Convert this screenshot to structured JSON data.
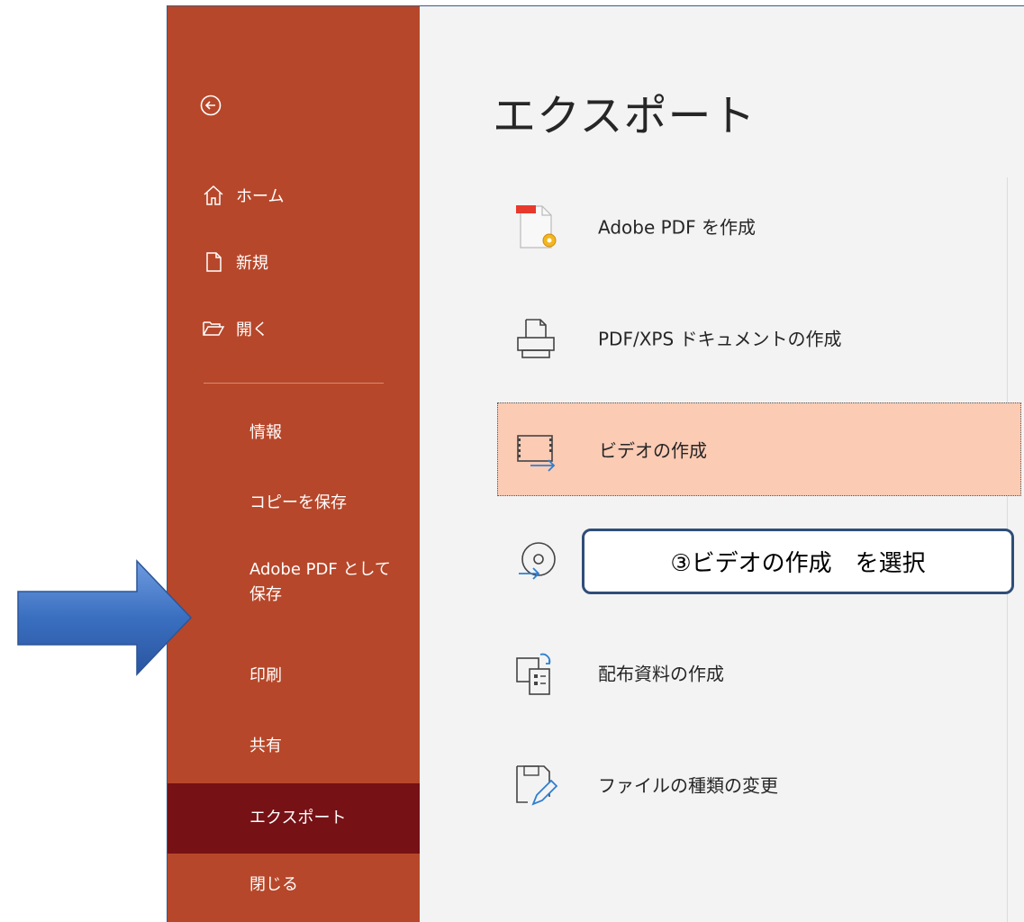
{
  "sidebar": {
    "top_items": [
      {
        "label": "ホーム",
        "icon": "home-icon"
      },
      {
        "label": "新規",
        "icon": "new-document-icon"
      },
      {
        "label": "開く",
        "icon": "open-folder-icon"
      }
    ],
    "items": [
      {
        "label": "情報"
      },
      {
        "label": "コピーを保存"
      },
      {
        "label": "Adobe PDF として保存"
      },
      {
        "label": "印刷"
      },
      {
        "label": "共有"
      },
      {
        "label": "エクスポート",
        "active": true
      },
      {
        "label": "閉じる"
      }
    ]
  },
  "main": {
    "title": "エクスポート",
    "options": [
      {
        "label": "Adobe PDF を作成",
        "icon": "adobe-pdf-icon"
      },
      {
        "label": "PDF/XPS ドキュメントの作成",
        "icon": "pdf-xps-icon"
      },
      {
        "label": "ビデオの作成",
        "icon": "video-icon",
        "selected": true
      },
      {
        "label": "",
        "icon": "cd-package-icon"
      },
      {
        "label": "配布資料の作成",
        "icon": "handout-icon"
      },
      {
        "label": "ファイルの種類の変更",
        "icon": "change-file-type-icon"
      }
    ]
  },
  "annotation": {
    "callout_text": "③ビデオの作成　を選択"
  },
  "colors": {
    "sidebar": "#b7472a",
    "sidebar_active": "#761115",
    "selected_option": "#fbcbb4",
    "arrow": "#3a6fc0"
  }
}
